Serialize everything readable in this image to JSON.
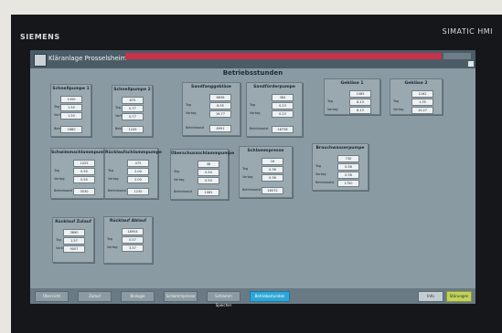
{
  "device": {
    "brand": "SIEMENS",
    "model": "SIMATIC HMI"
  },
  "header": {
    "title": "Kläranlage Prosselsheim",
    "alarm_text": "",
    "user_label": ""
  },
  "page": {
    "title": "Betriebsstunden"
  },
  "panels": [
    {
      "title": "Schnellpumpe 1",
      "rows": [
        {
          "label": "",
          "value": "1450"
        },
        {
          "label": "Tag",
          "value": "1.50"
        },
        {
          "label": "Vortag",
          "value": "1.50"
        }
      ],
      "total": {
        "label": "Betriebsstd",
        "value": "1880"
      }
    },
    {
      "title": "Schnellpumpe 2",
      "rows": [
        {
          "label": "",
          "value": "875"
        },
        {
          "label": "Tag",
          "value": "0.77"
        },
        {
          "label": "Vortag",
          "value": "0.77"
        }
      ],
      "total": {
        "label": "Betriebsstd",
        "value": "1245"
      }
    },
    {
      "title": "Sandfanggebläse",
      "rows": [
        {
          "label": "",
          "value": "8836"
        },
        {
          "label": "Tag",
          "value": "8.95"
        },
        {
          "label": "Vortag",
          "value": "16.77"
        }
      ],
      "total": {
        "label": "Betriebsstd",
        "value": "8991"
      }
    },
    {
      "title": "Sandförderpumpe",
      "rows": [
        {
          "label": "",
          "value": "384"
        },
        {
          "label": "Tag",
          "value": "0.23"
        },
        {
          "label": "Vortag",
          "value": "0.23"
        }
      ],
      "total": {
        "label": "Betriebsstd",
        "value": "16738"
      }
    },
    {
      "title": "Gebläse 1",
      "rows": [
        {
          "label": "",
          "value": "1085"
        },
        {
          "label": "Tag",
          "value": "8.13"
        },
        {
          "label": "Vortag",
          "value": "8.13"
        }
      ],
      "total": null
    },
    {
      "title": "Gebläse 2",
      "rows": [
        {
          "label": "",
          "value": "1162"
        },
        {
          "label": "Tag",
          "value": "1.35"
        },
        {
          "label": "Vortag",
          "value": "10.27"
        }
      ],
      "total": null
    },
    {
      "title": "Schwimmschlammpumpe",
      "rows": [
        {
          "label": "",
          "value": "1025"
        },
        {
          "label": "Tag",
          "value": "0.50"
        },
        {
          "label": "Vortag",
          "value": "0.50"
        }
      ],
      "total": {
        "label": "Betriebsstd",
        "value": "3030"
      }
    },
    {
      "title": "Rücklaufschlammpumpe",
      "rows": [
        {
          "label": "",
          "value": "475"
        },
        {
          "label": "Tag",
          "value": "2.00"
        },
        {
          "label": "Vortag",
          "value": "2.00"
        }
      ],
      "total": {
        "label": "Betriebsstd",
        "value": "1230"
      }
    },
    {
      "title": "Überschussschlammpumpe",
      "rows": [
        {
          "label": "",
          "value": "48"
        },
        {
          "label": "Tag",
          "value": "0.50"
        },
        {
          "label": "Vortag",
          "value": "0.50"
        }
      ],
      "total": {
        "label": "Betriebsstd",
        "value": "1082"
      }
    },
    {
      "title": "Schlammpresse",
      "rows": [
        {
          "label": "",
          "value": "16"
        },
        {
          "label": "Tag",
          "value": "0.36"
        },
        {
          "label": "Vortag",
          "value": "0.36"
        }
      ],
      "total": {
        "label": "Betriebsstd",
        "value": "16572"
      }
    },
    {
      "title": "Brauchwasserpumpe",
      "rows": [
        {
          "label": "",
          "value": "730"
        },
        {
          "label": "Tag",
          "value": "0.36"
        },
        {
          "label": "Vortag",
          "value": "0.36"
        }
      ],
      "total": {
        "label": "Betriebsstd",
        "value": "1700"
      }
    },
    {
      "title": "Rücklauf Zulauf",
      "rows": [
        {
          "label": "",
          "value": "3890"
        },
        {
          "label": "Tag",
          "value": "1.57"
        },
        {
          "label": "Vortag",
          "value": "9007"
        }
      ],
      "total": null
    },
    {
      "title": "Rücklauf Ablauf",
      "rows": [
        {
          "label": "",
          "value": "18954"
        },
        {
          "label": "Tag",
          "value": "0.57"
        },
        {
          "label": "Vortag",
          "value": "3.57"
        }
      ],
      "total": null
    }
  ],
  "nav": [
    {
      "label": "Übersicht"
    },
    {
      "label": "Zulauf"
    },
    {
      "label": "Biologie"
    },
    {
      "label": "Schlammpresse"
    },
    {
      "label": "Schlamm Speicher"
    },
    {
      "label": "Betriebsstunden"
    },
    {
      "label": "Info"
    },
    {
      "label": "Störungen"
    }
  ],
  "colors": {
    "screen_bg": "#8a9aa3",
    "titlebar": "#4b5c67",
    "alarm": "#c8324a",
    "active_nav": "#2ea7d8",
    "ack_button": "#c3d35a"
  }
}
